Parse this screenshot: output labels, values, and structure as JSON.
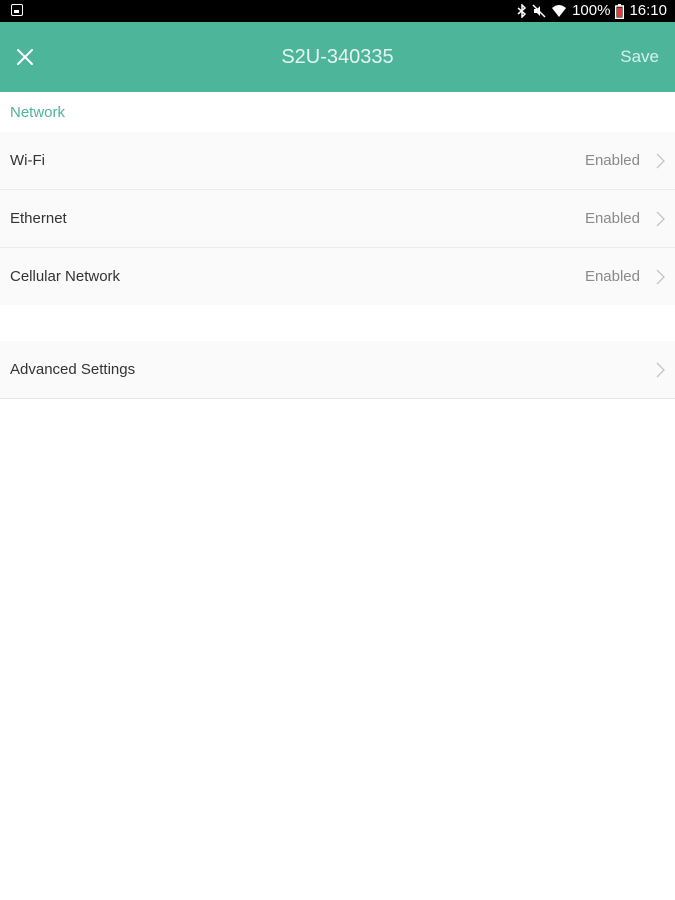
{
  "status_bar": {
    "battery": "100%",
    "time": "16:10",
    "icons": [
      "screenshot-icon",
      "bluetooth-icon",
      "mute-icon",
      "wifi-icon",
      "battery-icon"
    ]
  },
  "app_bar": {
    "title": "S2U-340335",
    "save_label": "Save",
    "close_icon": "close-icon",
    "background": "#4db59a"
  },
  "network_section": {
    "header": "Network",
    "items": [
      {
        "label": "Wi-Fi",
        "value": "Enabled"
      },
      {
        "label": "Ethernet",
        "value": "Enabled"
      },
      {
        "label": "Cellular Network",
        "value": "Enabled"
      }
    ]
  },
  "advanced_section": {
    "items": [
      {
        "label": "Advanced Settings"
      }
    ]
  },
  "colors": {
    "accent": "#4db59a",
    "row_background": "#fafafa",
    "value_text": "#8a8a8a"
  }
}
